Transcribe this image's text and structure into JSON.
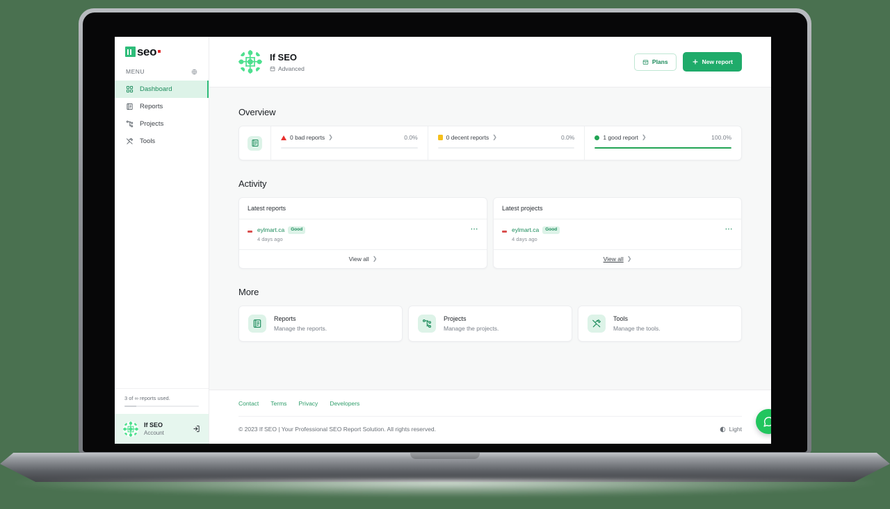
{
  "sidebar": {
    "logo": {
      "text": "seo.",
      "mark_label": "if"
    },
    "menu_heading": "MENU",
    "menu_icon": "globe-icon",
    "items": [
      {
        "label": "Dashboard",
        "icon": "grid-icon",
        "active": true
      },
      {
        "label": "Reports",
        "icon": "report-icon",
        "active": false
      },
      {
        "label": "Projects",
        "icon": "sitemap-icon",
        "active": false
      },
      {
        "label": "Tools",
        "icon": "tools-icon",
        "active": false
      }
    ],
    "quota_text": "3 of ∞ reports used.",
    "account": {
      "name": "If SEO",
      "role": "Account",
      "action_icon": "logout-icon"
    }
  },
  "header": {
    "title": "If SEO",
    "plan": "Advanced",
    "plan_icon": "calendar-icon",
    "buttons": {
      "plans": {
        "label": "Plans",
        "icon": "plans-icon"
      },
      "new_report": {
        "label": "New report",
        "icon": "plus-icon"
      }
    }
  },
  "overview": {
    "title": "Overview",
    "icon": "report-icon",
    "stats": [
      {
        "label": "0 bad reports",
        "pct": "0.0%",
        "marker": "triangle",
        "color": "#e8312f",
        "fill": 0
      },
      {
        "label": "0 decent reports",
        "pct": "0.0%",
        "marker": "square",
        "color": "#f5bf1b",
        "fill": 0
      },
      {
        "label": "1 good report",
        "pct": "100.0%",
        "marker": "circle",
        "color": "#22a454",
        "fill": 100
      }
    ]
  },
  "activity": {
    "title": "Activity",
    "cards": [
      {
        "heading": "Latest reports",
        "items": [
          {
            "name": "eylmart.ca",
            "badge": "Good",
            "time": "4 days ago",
            "menu_icon": "kebab-icon"
          }
        ],
        "view_all": "View all",
        "underlined": false
      },
      {
        "heading": "Latest projects",
        "items": [
          {
            "name": "eylmart.ca",
            "badge": "Good",
            "time": "4 days ago",
            "menu_icon": "kebab-icon"
          }
        ],
        "view_all": "View all",
        "underlined": true
      }
    ]
  },
  "more": {
    "title": "More",
    "cards": [
      {
        "title": "Reports",
        "desc": "Manage the reports.",
        "icon": "report-icon"
      },
      {
        "title": "Projects",
        "desc": "Manage the projects.",
        "icon": "sitemap-icon"
      },
      {
        "title": "Tools",
        "desc": "Manage the tools.",
        "icon": "tools-icon"
      }
    ]
  },
  "footer": {
    "links": [
      "Contact",
      "Terms",
      "Privacy",
      "Developers"
    ],
    "copyright": "© 2023 If SEO | Your Professional SEO Report Solution. All rights reserved.",
    "theme": {
      "label": "Light",
      "icon": "contrast-icon"
    }
  },
  "chat_fab": {
    "icon": "chat-icon"
  },
  "colors": {
    "accent": "#1fab6a",
    "accent_soft": "#ddf3e8",
    "bad": "#e8312f",
    "decent": "#f5bf1b",
    "good": "#22a454",
    "page_bg": "#f7f8f8",
    "desktop_bg": "#4a7150"
  }
}
